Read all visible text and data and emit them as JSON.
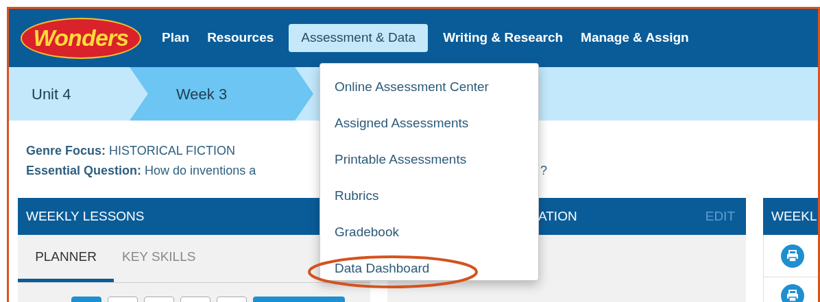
{
  "logo": {
    "text": "Wonders"
  },
  "nav": [
    {
      "label": "Plan",
      "selected": false
    },
    {
      "label": "Resources",
      "selected": false
    },
    {
      "label": "Assessment & Data",
      "selected": true
    },
    {
      "label": "Writing & Research",
      "selected": false
    },
    {
      "label": "Manage & Assign",
      "selected": false
    }
  ],
  "breadcrumb": [
    {
      "label": "Unit 4",
      "selected": false
    },
    {
      "label": "Week 3",
      "selected": true
    }
  ],
  "genre": {
    "label": "Genre Focus:",
    "value": "HISTORICAL FICTION"
  },
  "essential_question": {
    "label": "Essential Question:",
    "value": "How do inventions a",
    "end": "?"
  },
  "panels": [
    {
      "title": "WEEKLY LESSONS",
      "tabs": [
        {
          "label": "PLANNER",
          "selected": true
        },
        {
          "label": "KEY SKILLS",
          "selected": false
        }
      ],
      "day_buttons": [
        {
          "selected": true
        },
        {
          "selected": false
        },
        {
          "selected": false
        },
        {
          "selected": false
        },
        {
          "selected": false
        }
      ]
    },
    {
      "title": "ATION",
      "action": "EDIT"
    },
    {
      "title": "WEEKL"
    }
  ],
  "dropdown": {
    "items": [
      {
        "label": "Online Assessment Center",
        "highlighted": false
      },
      {
        "label": "Assigned Assessments",
        "highlighted": false
      },
      {
        "label": "Printable Assessments",
        "highlighted": false
      },
      {
        "label": "Rubrics",
        "highlighted": false
      },
      {
        "label": "Gradebook",
        "highlighted": false
      },
      {
        "label": "Data Dashboard",
        "highlighted": true
      }
    ]
  }
}
